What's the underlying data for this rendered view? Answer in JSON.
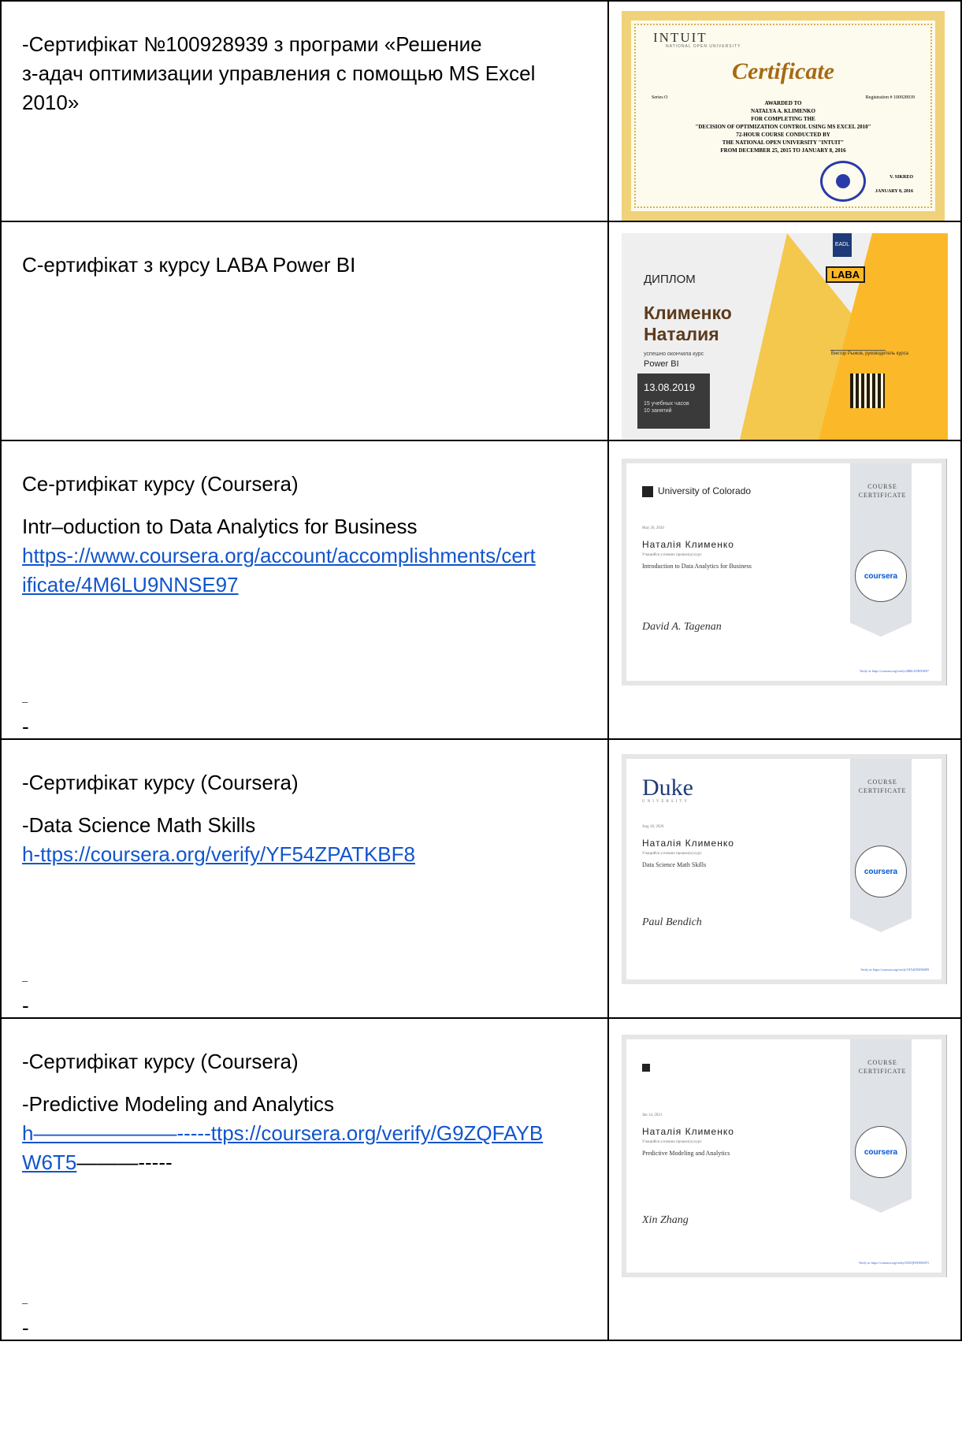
{
  "rows": [
    {
      "lines": [
        "-Сертифікат №100928939 з програми «Решение",
        "з-адач оптимизации управления с помощью MS Excel",
        "2010»"
      ]
    },
    {
      "lines": [
        "С-ертифікат з курсу LABA  Power BI"
      ]
    },
    {
      "heading": "Се-ртифікат курсу (Coursera)",
      "course": "Intr–oduction to Data Analytics for Business",
      "link": "https-://www.coursera.org/account/accomplishments/certificate/4M6LU9NNSE97",
      "link_line1": "https-://www.coursera.org/account/accomplishments/cert",
      "link_line2": "ificate/4M6LU9NNSE97",
      "tiny": "–",
      "dash": "-"
    },
    {
      "heading": "-Сертифікат курсу (Coursera)",
      "course": "-Data Science Math Skills",
      "link": "h-ttps://coursera.org/verify/YF54ZPATKBF8",
      "tiny": "–",
      "dash": "-"
    },
    {
      "heading": "-Сертифікат курсу (Coursera)",
      "course": "-Predictive Modeling and Analytics",
      "link_line1": "h———————-----ttps://coursera.org/verify/G9ZQFAYB",
      "link_line2": "W6T5",
      "trail": "———-----",
      "tiny": "–",
      "dash": "-"
    }
  ],
  "intuit": {
    "brand": "INTUIT",
    "brand_sub": "NATIONAL OPEN UNIVERSITY",
    "title": "Certificate",
    "series": "Series O",
    "registration": "Registration # 100928939",
    "body": [
      "AWARDED TO",
      "NATALYA A. KLIMENKO",
      "FOR COMPLETING THE",
      "\"DECISION OF OPTIMIZATION CONTROL USING MS EXCEL 2010\"",
      "72-HOUR COURSE CONDUCTED BY",
      "THE NATIONAL OPEN UNIVERSITY \"INTUIT\"",
      "FROM DECEMBER 25, 2015 TO JANUARY 8, 2016"
    ],
    "signer": "V. SIKREO",
    "dated": "JANUARY 8, 2016"
  },
  "laba": {
    "eadl": "EADL",
    "logo": "LABA",
    "diploma": "ДИПЛОМ",
    "name1": "Клименко",
    "name2": "Наталия",
    "done": "успешно окончила курс",
    "course": "Power BI",
    "date": "13.08.2019",
    "hours1": "15 учебных часов",
    "hours2": "10 занятий",
    "signer": "Виктор Рыжов, руководитель курса"
  },
  "coursera": [
    {
      "uni": "University of Colorado",
      "cc1": "COURSE",
      "cc2": "CERTIFICATE",
      "date": "May 26, 2020",
      "person": "Наталія Клименко",
      "done": "Учащийся успешно прошел(а) курс",
      "course": "Introduction to Data Analytics for Business",
      "emblem": "coursera",
      "sign": "David A. Tagenan",
      "verify": "Verify at: https://coursera.org/verify/4M6LU9NNSE97"
    },
    {
      "uni": "Duke",
      "uni_sub": "UNIVERSITY",
      "cc1": "COURSE",
      "cc2": "CERTIFICATE",
      "date": "Aug 18, 2020",
      "person": "Наталія Клименко",
      "done": "Учащийся успешно прошел(а) курс",
      "course": "Data Science Math Skills",
      "emblem": "coursera",
      "sign": "Paul Bendich",
      "verify": "Verify at: https://coursera.org/verify/YF54ZPATKBF8"
    },
    {
      "cc1": "COURSE",
      "cc2": "CERTIFICATE",
      "date": "Jan 14, 2021",
      "person": "Наталія Клименко",
      "done": "Учащийся успешно прошел(а) курс",
      "course": "Predictive Modeling and Analytics",
      "emblem": "coursera",
      "sign": "Xin Zhang",
      "verify": "Verify at: https://coursera.org/verify/G9ZQFAYBW6T5"
    }
  ]
}
